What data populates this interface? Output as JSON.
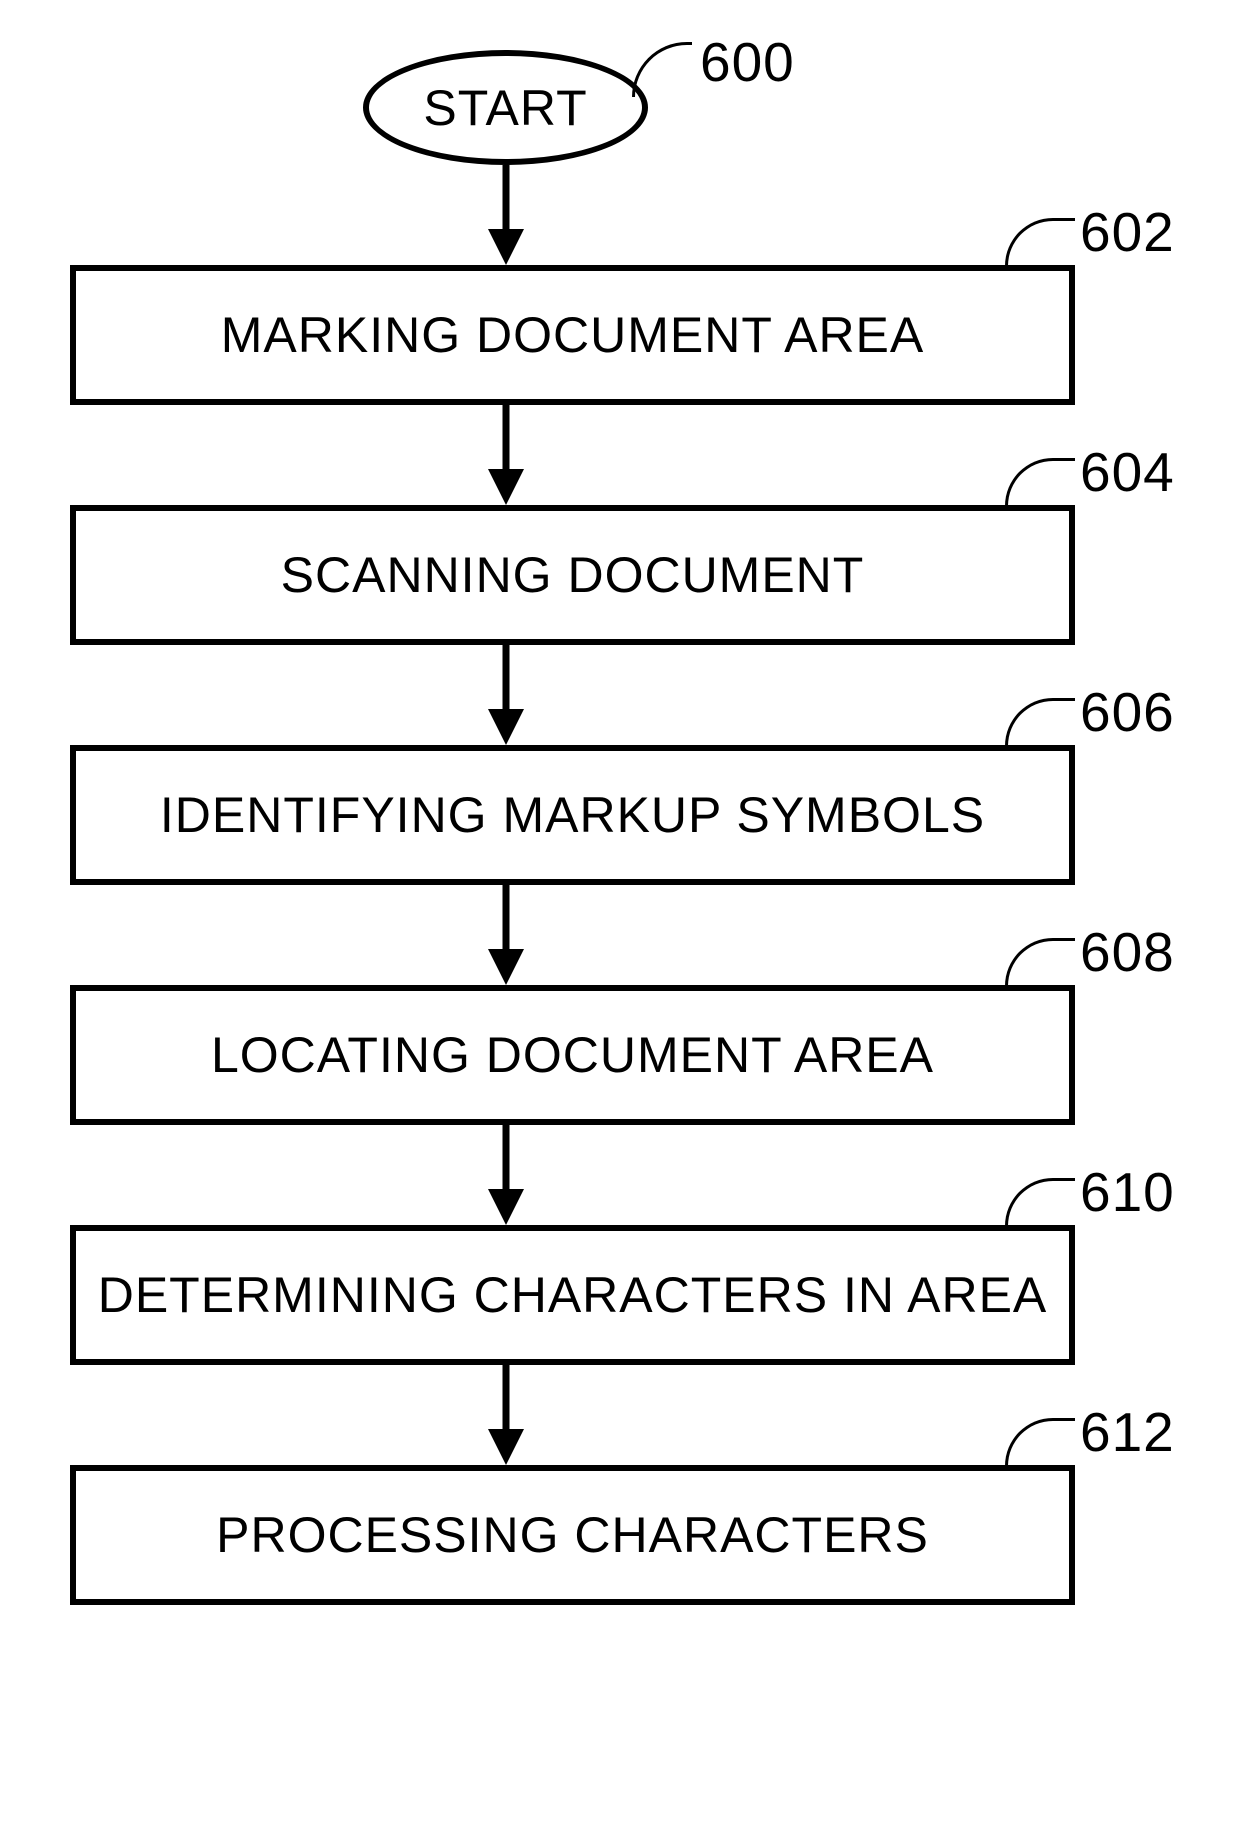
{
  "start": {
    "label": "START",
    "ref": "600"
  },
  "steps": [
    {
      "label": "MARKING DOCUMENT AREA",
      "ref": "602"
    },
    {
      "label": "SCANNING DOCUMENT",
      "ref": "604"
    },
    {
      "label": "IDENTIFYING MARKUP SYMBOLS",
      "ref": "606"
    },
    {
      "label": "LOCATING DOCUMENT AREA",
      "ref": "608"
    },
    {
      "label": "DETERMINING CHARACTERS IN AREA",
      "ref": "610"
    },
    {
      "label": "PROCESSING CHARACTERS",
      "ref": "612"
    }
  ]
}
